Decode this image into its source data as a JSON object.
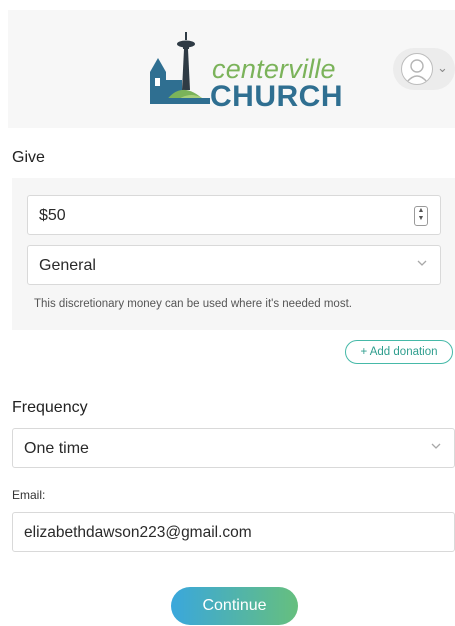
{
  "header": {
    "logo_line1": "centerville",
    "logo_line2": "CHURCH",
    "avatar_chevron": "⌄",
    "icons": {
      "logo": "church-logo-icon",
      "avatar": "user-avatar-icon",
      "chevron": "chevron-down-icon"
    }
  },
  "give": {
    "title": "Give",
    "amount_value": "$50",
    "fund_value": "General",
    "fund_description": "This discretionary money can be used where it's needed most.",
    "add_donation_label": "+ Add donation"
  },
  "frequency": {
    "title": "Frequency",
    "value": "One time"
  },
  "email": {
    "label": "Email:",
    "value": "elizabethdawson223@gmail.com"
  },
  "actions": {
    "continue_label": "Continue"
  },
  "colors": {
    "logo_green": "#7bb35a",
    "logo_blue": "#2f6f91",
    "accent_teal": "#46b9a8",
    "button_gradient_start": "#3aa7dc",
    "button_gradient_end": "#66bf7e"
  }
}
